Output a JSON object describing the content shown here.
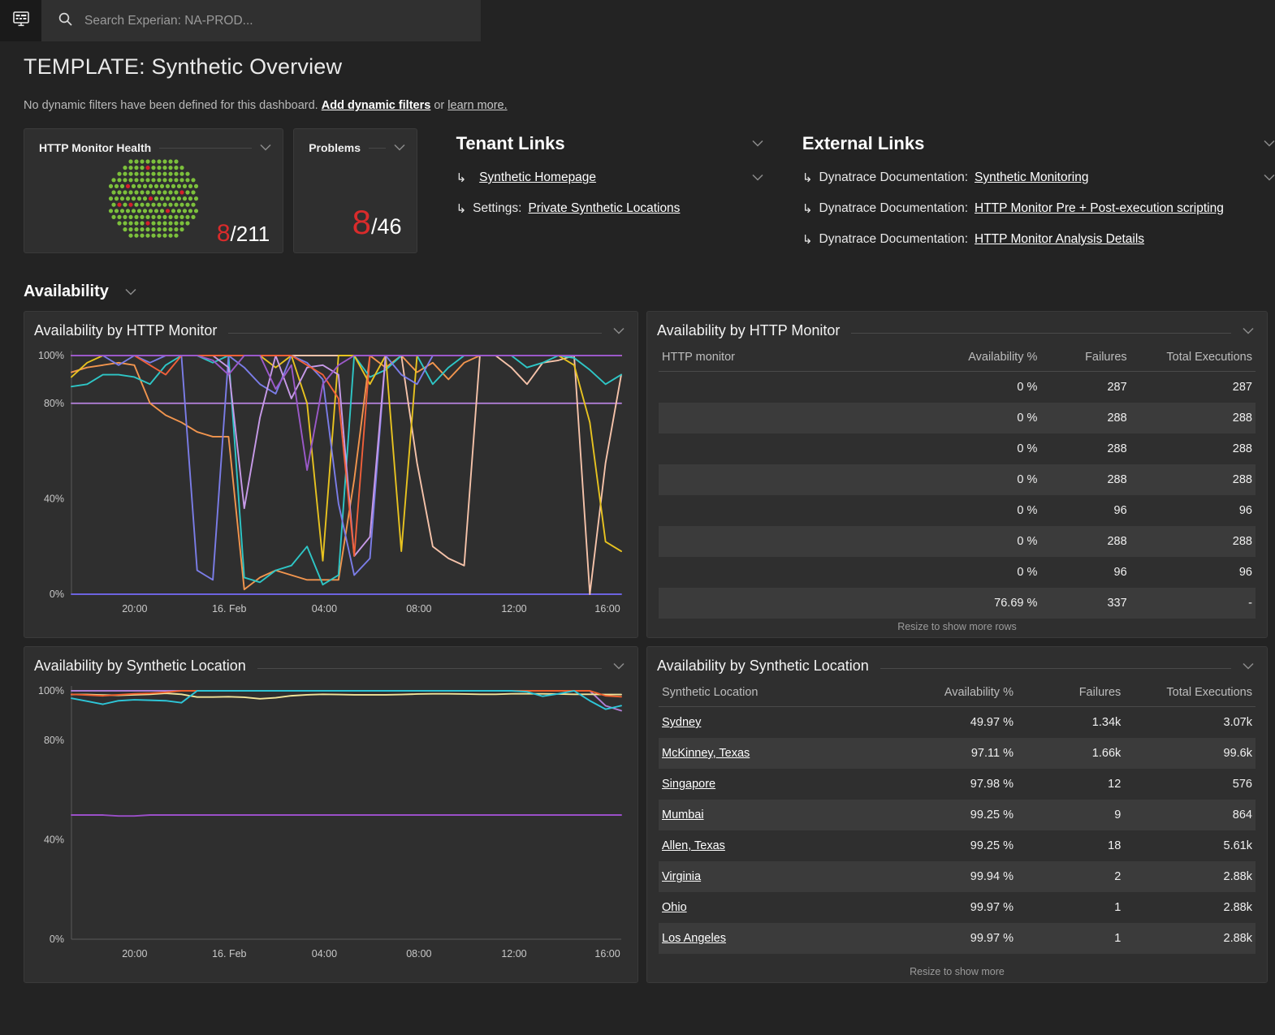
{
  "topbar": {
    "app_icon": "dashboard-icon",
    "search_icon": "search-icon",
    "search_placeholder": "Search Experian: NA-PROD..."
  },
  "header": {
    "title": "TEMPLATE: Synthetic Overview",
    "filter_note_prefix": "No dynamic filters have been defined for this dashboard.",
    "filter_note_link": "Add dynamic filters",
    "filter_note_middle": "or",
    "filter_note_link2": "learn more."
  },
  "tiles": [
    {
      "title": "HTTP Monitor Health",
      "value_bad": "8",
      "value_total": "/211",
      "honeycomb": {
        "total": 211,
        "failed": 8,
        "ok_color": "#7cc03c",
        "fail_color": "#d4202a"
      }
    },
    {
      "title": "Problems",
      "value_bad": "8",
      "value_total": "/46"
    }
  ],
  "tenant_links": {
    "title": "Tenant Links",
    "items": [
      {
        "prefix": "",
        "link": "Synthetic Homepage"
      },
      {
        "prefix": "Settings: ",
        "link": "Private Synthetic Locations"
      }
    ]
  },
  "external_links": {
    "title": "External Links",
    "items": [
      {
        "prefix": "Dynatrace Documentation: ",
        "link": "Synthetic Monitoring"
      },
      {
        "prefix": "Dynatrace Documentation: ",
        "link": "HTTP Monitor Pre + Post-execution scripting"
      },
      {
        "prefix": "Dynatrace Documentation: ",
        "link": "HTTP Monitor Analysis Details"
      }
    ]
  },
  "section": {
    "title": "Availability"
  },
  "monitor_table": {
    "title": "Availability by HTTP Monitor",
    "columns": [
      "HTTP monitor",
      "Availability %",
      "Failures",
      "Total Executions"
    ],
    "rows": [
      {
        "name": "",
        "availability": "0 %",
        "failures": "287",
        "total": "287"
      },
      {
        "name": "",
        "availability": "0 %",
        "failures": "288",
        "total": "288"
      },
      {
        "name": "",
        "availability": "0 %",
        "failures": "288",
        "total": "288"
      },
      {
        "name": "",
        "availability": "0 %",
        "failures": "288",
        "total": "288"
      },
      {
        "name": "",
        "availability": "0 %",
        "failures": "96",
        "total": "96"
      },
      {
        "name": "",
        "availability": "0 %",
        "failures": "288",
        "total": "288"
      },
      {
        "name": "",
        "availability": "0 %",
        "failures": "96",
        "total": "96"
      },
      {
        "name": "",
        "availability": "76.69 %",
        "failures": "337",
        "total": "-"
      }
    ],
    "footer": "Resize to show more rows"
  },
  "location_table": {
    "title": "Availability by Synthetic Location",
    "columns": [
      "Synthetic Location",
      "Availability %",
      "Failures",
      "Total Executions"
    ],
    "rows": [
      {
        "name": "Sydney",
        "availability": "49.97 %",
        "failures": "1.34k",
        "total": "3.07k"
      },
      {
        "name": "McKinney, Texas",
        "availability": "97.11 %",
        "failures": "1.66k",
        "total": "99.6k"
      },
      {
        "name": "Singapore",
        "availability": "97.98 %",
        "failures": "12",
        "total": "576"
      },
      {
        "name": "Mumbai",
        "availability": "99.25 %",
        "failures": "9",
        "total": "864"
      },
      {
        "name": "Allen, Texas",
        "availability": "99.25 %",
        "failures": "18",
        "total": "5.61k"
      },
      {
        "name": "Virginia",
        "availability": "99.94 %",
        "failures": "2",
        "total": "2.88k"
      },
      {
        "name": "Ohio",
        "availability": "99.97 %",
        "failures": "1",
        "total": "2.88k"
      },
      {
        "name": "Los Angeles",
        "availability": "99.97 %",
        "failures": "1",
        "total": "2.88k"
      }
    ],
    "footer": "Resize to show more"
  },
  "chart_data": [
    {
      "type": "line",
      "title": "Availability by HTTP Monitor",
      "xlabel": "",
      "ylabel": "",
      "ylim": [
        0,
        100
      ],
      "yticks": [
        0,
        40,
        80,
        100
      ],
      "ytick_labels": [
        "0%",
        "40%",
        "80%",
        "100%"
      ],
      "xtick_labels": [
        "20:00",
        "16. Feb",
        "04:00",
        "08:00",
        "12:00",
        "16:00"
      ],
      "xtick_positions": [
        0.115,
        0.287,
        0.46,
        0.632,
        0.805,
        0.975
      ],
      "grid": false,
      "legend": "none",
      "series": [
        {
          "name": "monitor-peach",
          "color": "#f3b79c",
          "values": [
            100,
            100,
            100,
            100,
            100,
            100,
            100,
            100,
            100,
            100,
            100,
            100,
            100,
            100,
            100,
            100,
            100,
            100,
            100,
            100,
            100,
            100,
            100,
            100,
            100,
            100,
            100,
            100,
            100,
            100,
            100,
            100,
            100,
            100,
            100,
            100
          ]
        },
        {
          "name": "monitor-violet",
          "color": "#b07fd6",
          "values": [
            80,
            80,
            80,
            80,
            80,
            80,
            80,
            80,
            80,
            80,
            80,
            80,
            80,
            80,
            80,
            80,
            80,
            80,
            80,
            80,
            80,
            80,
            80,
            80,
            80,
            80,
            80,
            80,
            80,
            80,
            80,
            80,
            80,
            80,
            80,
            80
          ]
        },
        {
          "name": "monitor-blue",
          "color": "#6c63e0",
          "values": [
            0,
            0,
            0,
            0,
            0,
            0,
            0,
            0,
            0,
            0,
            0,
            0,
            0,
            0,
            0,
            0,
            0,
            0,
            0,
            0,
            0,
            0,
            0,
            0,
            0,
            0,
            0,
            0,
            0,
            0,
            0,
            0,
            0,
            0,
            0,
            0
          ]
        },
        {
          "name": "monitor-orange",
          "color": "#f2954e",
          "values": [
            93,
            95,
            96,
            97,
            96,
            80,
            75,
            72,
            68,
            66,
            66,
            2,
            7,
            10,
            8,
            6,
            6,
            6,
            48,
            100,
            95,
            100,
            93,
            97,
            90,
            97,
            100,
            100,
            100,
            100,
            100,
            100,
            100,
            100,
            100,
            100
          ]
        },
        {
          "name": "monitor-salmon",
          "color": "#f6c3aa",
          "values": [
            100,
            100,
            100,
            100,
            100,
            100,
            100,
            100,
            100,
            100,
            100,
            100,
            100,
            100,
            100,
            100,
            100,
            100,
            100,
            100,
            100,
            100,
            55,
            20,
            15,
            12,
            100,
            100,
            95,
            88,
            97,
            98,
            100,
            0,
            55,
            92
          ]
        },
        {
          "name": "monitor-teal",
          "color": "#2ec6c6",
          "values": [
            87,
            88,
            92,
            92,
            91,
            88,
            96,
            100,
            100,
            97,
            100,
            7,
            5,
            10,
            12,
            20,
            4,
            8,
            100,
            91,
            94,
            100,
            100,
            88,
            95,
            100,
            100,
            100,
            100,
            95,
            97,
            100,
            99,
            94,
            88,
            92
          ]
        },
        {
          "name": "monitor-yellow",
          "color": "#e8c320",
          "values": [
            91,
            97,
            100,
            100,
            100,
            100,
            100,
            100,
            100,
            100,
            100,
            100,
            100,
            95,
            100,
            80,
            14,
            100,
            100,
            88,
            100,
            18,
            100,
            100,
            100,
            100,
            100,
            100,
            100,
            100,
            100,
            100,
            96,
            72,
            22,
            18
          ]
        },
        {
          "name": "monitor-indigo",
          "color": "#7b7de8",
          "values": [
            100,
            100,
            100,
            96,
            100,
            97,
            100,
            100,
            10,
            6,
            100,
            95,
            88,
            84,
            100,
            97,
            90,
            38,
            8,
            15,
            100,
            92,
            88,
            100,
            100,
            100,
            100,
            100,
            100,
            100,
            100,
            100,
            100,
            100,
            100,
            100
          ]
        },
        {
          "name": "monitor-lilac",
          "color": "#c79ae8",
          "values": [
            100,
            100,
            100,
            100,
            100,
            100,
            100,
            100,
            100,
            100,
            95,
            36,
            74,
            100,
            82,
            95,
            96,
            92,
            16,
            24,
            100,
            100,
            100,
            100,
            100,
            100,
            100,
            100,
            100,
            100,
            100,
            100,
            100,
            100,
            100,
            100
          ]
        },
        {
          "name": "monitor-red",
          "color": "#f0603a",
          "values": [
            100,
            100,
            100,
            100,
            100,
            96,
            92,
            100,
            100,
            100,
            100,
            100,
            100,
            100,
            100,
            96,
            92,
            82,
            16,
            100,
            100,
            100,
            100,
            100,
            100,
            100,
            100,
            100,
            100,
            100,
            100,
            100,
            100,
            100,
            100,
            100
          ]
        },
        {
          "name": "monitor-purple",
          "color": "#9b59c9",
          "values": [
            100,
            100,
            100,
            100,
            100,
            100,
            100,
            100,
            100,
            98,
            92,
            100,
            100,
            86,
            96,
            52,
            88,
            96,
            100,
            100,
            100,
            100,
            100,
            100,
            100,
            100,
            100,
            100,
            100,
            100,
            100,
            100,
            100,
            100,
            100,
            100
          ]
        }
      ]
    },
    {
      "type": "line",
      "title": "Availability by Synthetic Location",
      "xlabel": "",
      "ylabel": "",
      "ylim": [
        0,
        100
      ],
      "yticks": [
        0,
        40,
        80,
        100
      ],
      "ytick_labels": [
        "0%",
        "40%",
        "80%",
        "100%"
      ],
      "xtick_labels": [
        "20:00",
        "16. Feb",
        "04:00",
        "08:00",
        "12:00",
        "16:00"
      ],
      "xtick_positions": [
        0.115,
        0.287,
        0.46,
        0.632,
        0.805,
        0.975
      ],
      "grid": false,
      "legend": "none",
      "series": [
        {
          "name": "location-purple-flat",
          "color": "#9b4fc9",
          "values": [
            50,
            50,
            50,
            49.6,
            49.6,
            50,
            50,
            50,
            50,
            50,
            50,
            50,
            50,
            50,
            50,
            50,
            50,
            50,
            50,
            50,
            50,
            50,
            50,
            50,
            50,
            50,
            50,
            50,
            50,
            50,
            50,
            50,
            50,
            50,
            50,
            50
          ]
        },
        {
          "name": "location-violet-top",
          "color": "#b07fd6",
          "values": [
            100,
            100,
            100,
            100,
            100,
            100,
            100,
            100,
            100,
            100,
            100,
            100,
            100,
            100,
            100,
            100,
            100,
            100,
            100,
            100,
            100,
            100,
            100,
            100,
            100,
            100,
            100,
            100,
            100,
            100,
            100,
            100,
            100,
            100,
            94,
            92
          ]
        },
        {
          "name": "location-yellow",
          "color": "#f2e49a",
          "values": [
            98.5,
            98.5,
            98.3,
            98.2,
            98.4,
            98.6,
            99,
            98.6,
            97.5,
            97.5,
            97.6,
            97.4,
            96.8,
            97.2,
            98,
            98.4,
            98.6,
            98.5,
            98.4,
            98.4,
            98.4,
            98.5,
            98.7,
            98.8,
            98.8,
            98.7,
            98.6,
            98.6,
            98.8,
            98.8,
            98.8,
            98.7,
            98.6,
            98.6,
            98.5,
            98.5
          ]
        },
        {
          "name": "location-orange",
          "color": "#f0602e",
          "values": [
            98.6,
            98.3,
            98,
            98.4,
            98.8,
            99,
            99.4,
            100,
            100,
            100,
            100,
            100,
            100,
            100,
            100,
            100,
            100,
            100,
            100,
            100,
            100,
            100,
            100,
            100,
            100,
            100,
            100,
            100,
            100,
            100,
            100,
            100,
            100,
            100,
            98,
            97.6
          ]
        },
        {
          "name": "location-cyan",
          "color": "#2ec6d8",
          "values": [
            97,
            95.8,
            94.6,
            96,
            96.4,
            96.2,
            96,
            95.2,
            100,
            100,
            100,
            100,
            100,
            100,
            100,
            100,
            100,
            100,
            100,
            100,
            100,
            100,
            100,
            100,
            100,
            100,
            100,
            100,
            100,
            99.6,
            97.8,
            98.8,
            100,
            96,
            92.6,
            94
          ]
        }
      ]
    }
  ]
}
